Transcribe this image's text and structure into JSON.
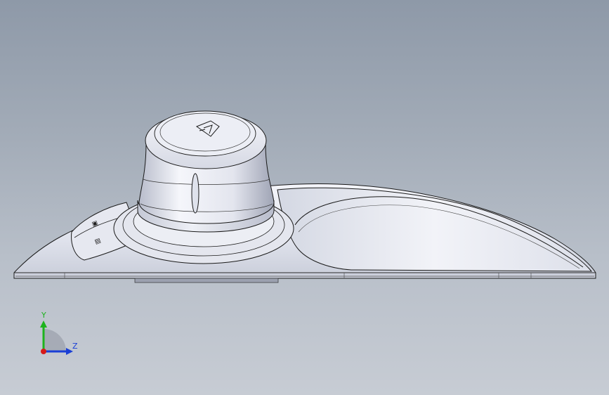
{
  "viewport": {
    "background_top": "#8e99a8",
    "background_bottom": "#c7ccd4"
  },
  "model": {
    "name": "3d-mouse-controller",
    "color": "#e8eaf2",
    "edge_color": "#1a1a1a"
  },
  "triad": {
    "y_label": "Y",
    "z_label": "Z",
    "y_color": "#1db31d",
    "z_color": "#1a3fd6",
    "x_color": "#d61a1a"
  }
}
